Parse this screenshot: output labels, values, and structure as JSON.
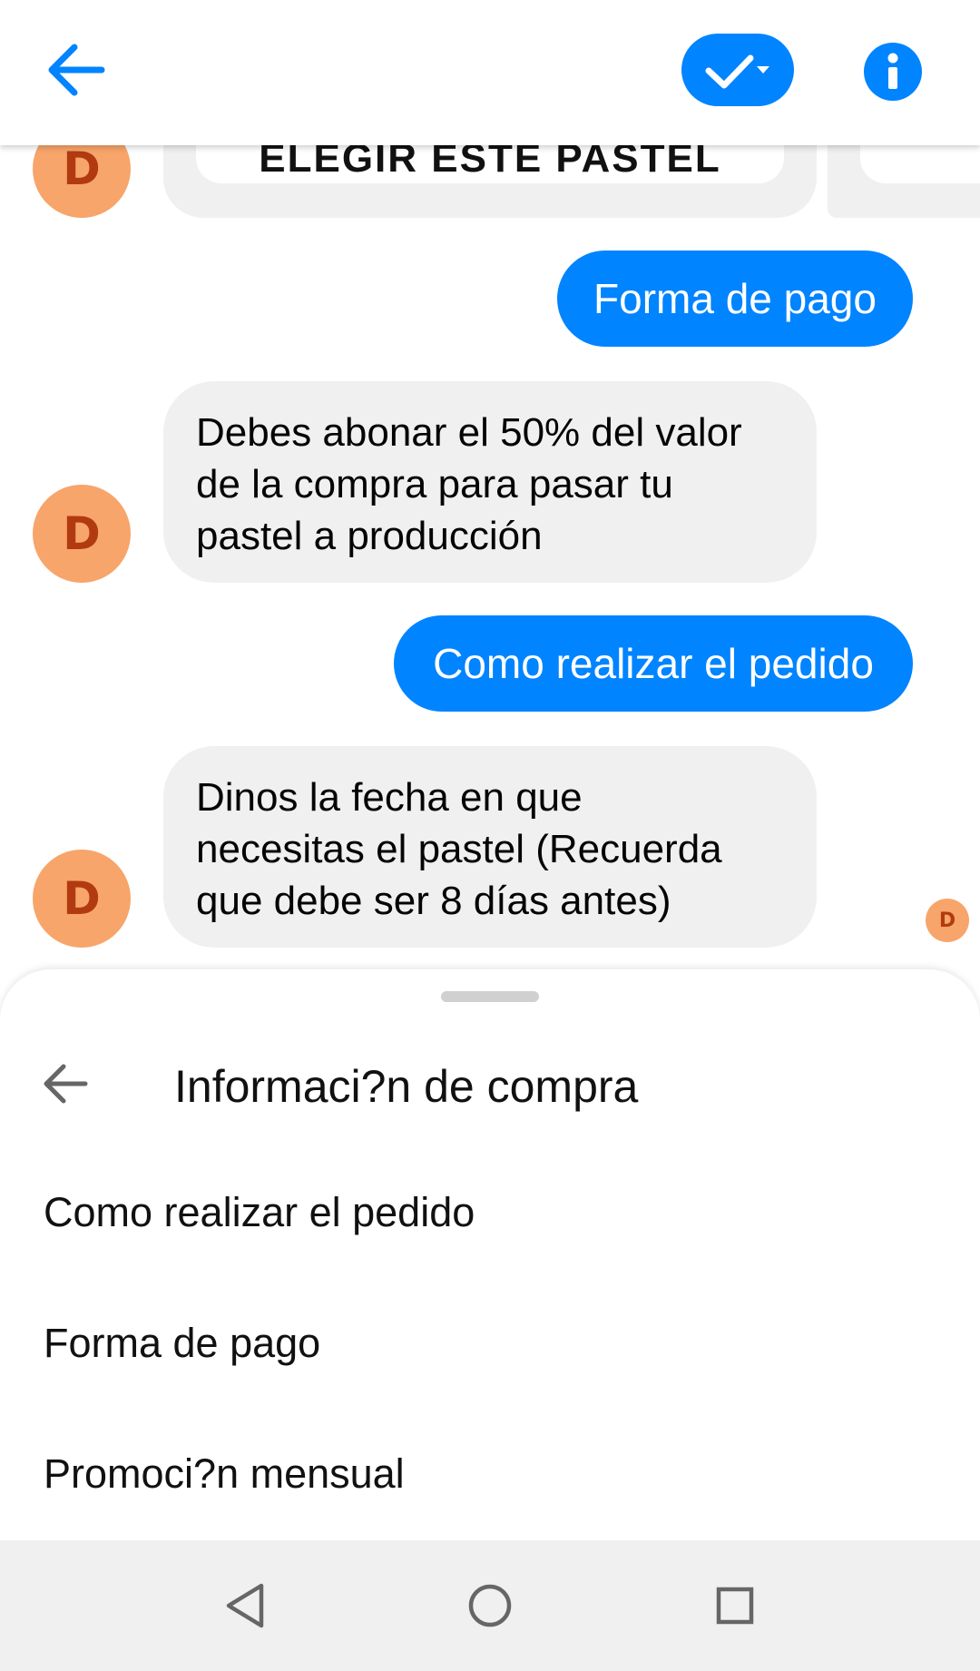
{
  "header": {
    "back_icon": "arrow-left-icon",
    "status_icon": "check-dropdown-icon",
    "info_icon": "info-icon",
    "accent": "#0084ff"
  },
  "chat": {
    "partial_card_text": "ELEGIR ESTE PASTEL",
    "avatar_letter": "D",
    "messages": [
      {
        "from": "me",
        "text": "Forma de pago"
      },
      {
        "from": "bot",
        "lines": [
          "Debes abonar el 50% del valor",
          "de la compra para pasar tu",
          "pastel a producción"
        ]
      },
      {
        "from": "me",
        "text": "Como realizar el pedido"
      },
      {
        "from": "bot",
        "lines": [
          "Dinos la fecha en que",
          "necesitas el pastel (Recuerda",
          "que debe ser 8 días antes)"
        ]
      }
    ],
    "read_receipt_letter": "D"
  },
  "sheet": {
    "title": "Informaci?n de compra",
    "items": [
      {
        "label": "Como realizar el pedido"
      },
      {
        "label": "Forma de pago"
      },
      {
        "label": "Promoci?n mensual"
      }
    ]
  },
  "navbar": {
    "back_icon": "nav-back-icon",
    "home_icon": "nav-home-icon",
    "recents_icon": "nav-recents-icon"
  }
}
